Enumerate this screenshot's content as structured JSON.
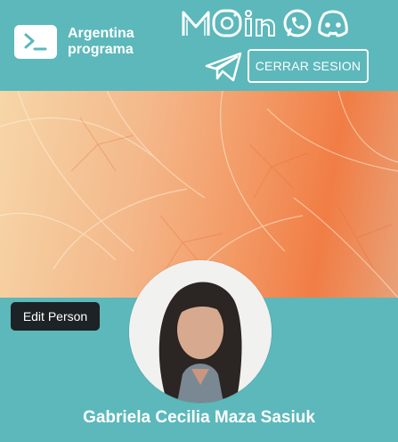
{
  "header": {
    "brand_line1": "Argentina",
    "brand_line2": "programa",
    "logout_label": "CERRAR SESION"
  },
  "social": {
    "logo_text": "MOin",
    "icons": [
      "instagram-icon",
      "linkedin-icon",
      "whatsapp-icon",
      "discord-icon",
      "telegram-icon"
    ]
  },
  "profile": {
    "edit_label": "Edit Person",
    "name": "Gabriela Cecilia Maza Sasiuk"
  },
  "colors": {
    "header_bg": "#5cb8bb",
    "button_dark": "#1d2226",
    "banner_accent": "#f17d45"
  }
}
